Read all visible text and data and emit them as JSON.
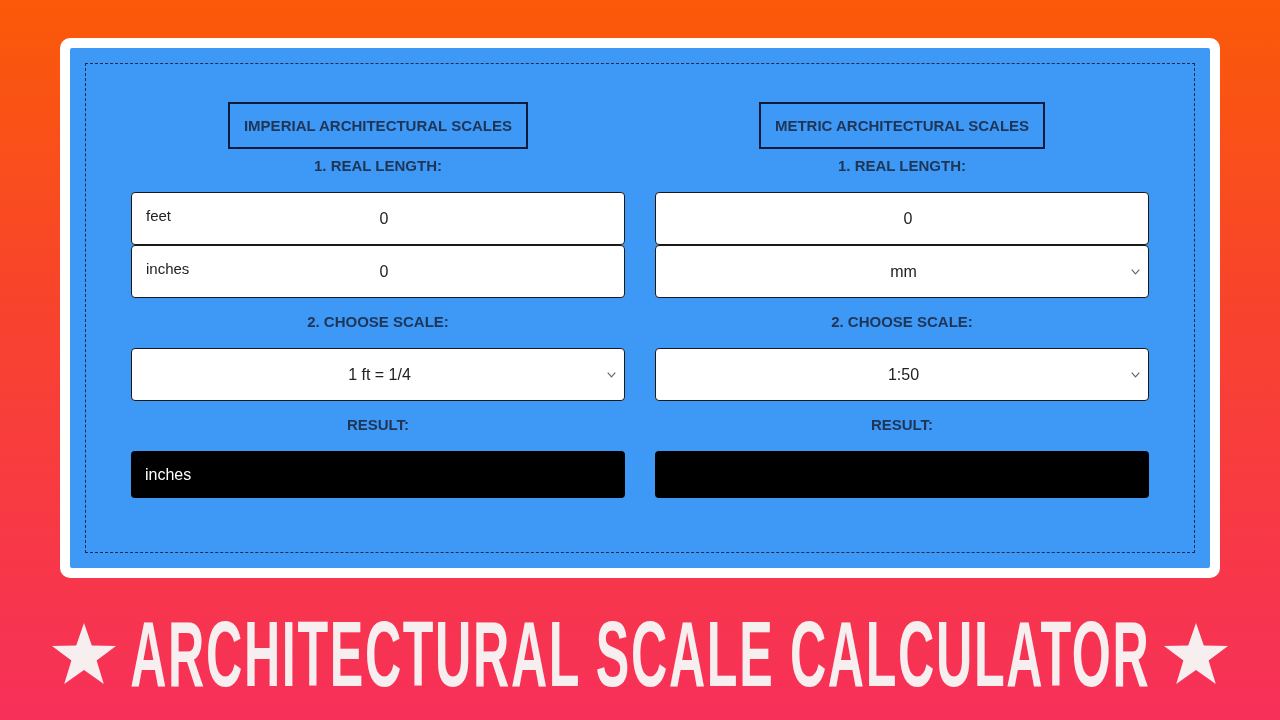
{
  "calculators": [
    {
      "title": "IMPERIAL ARCHITECTURAL SCALES",
      "length_label": "1. REAL LENGTH:",
      "length_fields": [
        {
          "kind": "input",
          "label": "feet",
          "value": "0"
        },
        {
          "kind": "input",
          "label": "inches",
          "value": "0"
        }
      ],
      "scale_label": "2. CHOOSE SCALE:",
      "scale": {
        "value": "1 ft = 1/4"
      },
      "result_label": "RESULT:",
      "result_text": "inches"
    },
    {
      "title": "METRIC ARCHITECTURAL SCALES",
      "length_label": "1. REAL LENGTH:",
      "length_fields": [
        {
          "kind": "input",
          "value": "0"
        },
        {
          "kind": "dropdown",
          "value": "mm"
        }
      ],
      "scale_label": "2. CHOOSE SCALE:",
      "scale": {
        "value": "1:50"
      },
      "result_label": "RESULT:"
    }
  ],
  "banner": {
    "title": "ARCHITECTURAL SCALE CALCULATOR"
  }
}
